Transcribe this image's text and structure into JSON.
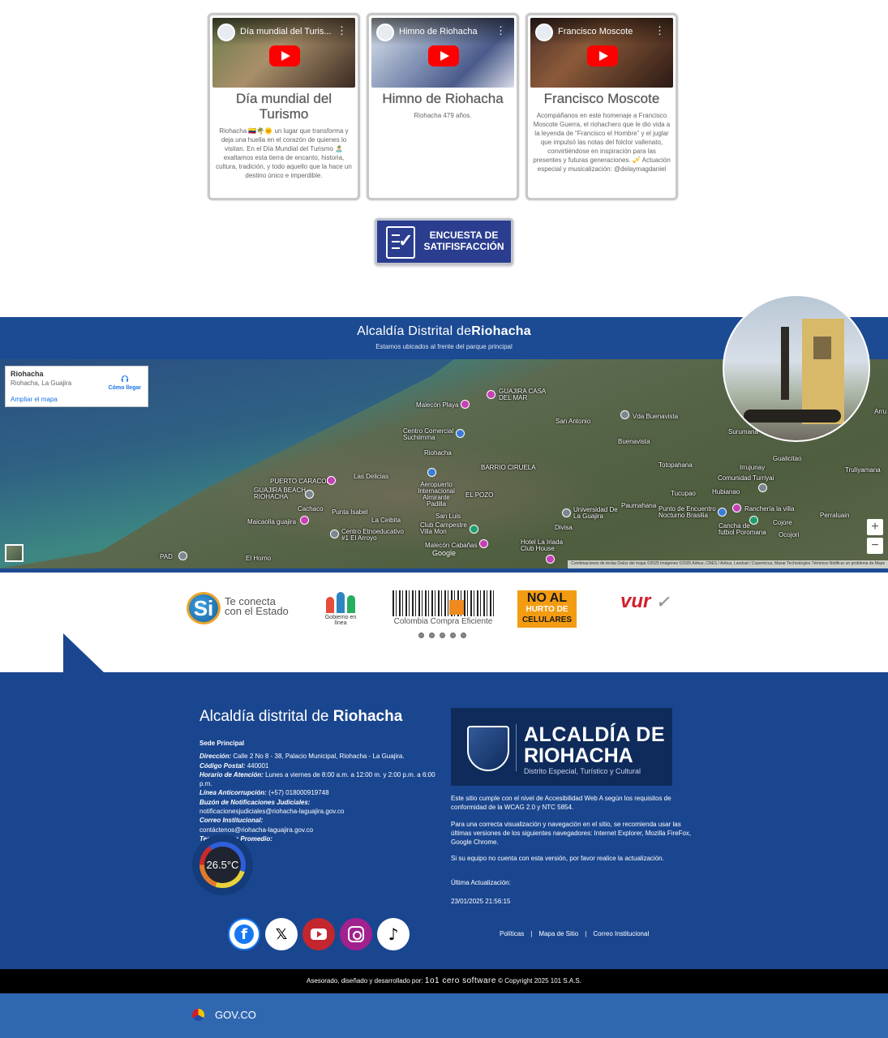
{
  "videos": [
    {
      "thumb_title": "Día mundial del Turis...",
      "title": "Día mundial del Turismo",
      "desc": "Riohacha 🇨🇴🌴🌞 un lugar que transforma y deja una huella en el corazón de quienes lo visitan. En el Día Mundial del Turismo 🏝️ exaltamos esta tierra de encanto, historia, cultura, tradición, y todo aquello que la hace un destino único e imperdible."
    },
    {
      "thumb_title": "Himno de Riohacha",
      "title": "Himno de Riohacha",
      "desc": "Riohacha 479 años."
    },
    {
      "thumb_title": "Francisco Moscote",
      "title": "Francisco Moscote",
      "desc": "Acompáñanos en este homenaje a Francisco Moscote Guerra, el riohachero que le dio vida a la leyenda de “Francisco el Hombre” y el juglar que impulsó las notas del folclor vallenato, convirtiéndose en inspiración para las presentes y futuras generaciones. 🎺 Actuación especial y musicalización: @delaymagdaniel"
    }
  ],
  "survey": {
    "line1": "ENCUESTA DE",
    "line2": "SATIFISFACCIÓN"
  },
  "map": {
    "title_prefix": "Alcaldía Distrital de",
    "title_bold": "Riohacha",
    "subtitle": "Estamos ubicados al frente del parque principal",
    "info_name": "Riohacha",
    "info_sub": "Riohacha, La Guajira",
    "info_link": "Ampliar el mapa",
    "info_dir": "Cómo llegar",
    "places": [
      "Malecón Playa",
      "GUAJIRA CASA DEL MAR",
      "San Antonio",
      "Vda Buenavista",
      "Centro Comercial Suchiimma",
      "Buenavista",
      "Surumana",
      "Arru",
      "Riohacha",
      "Totopahana",
      "Irrujunay",
      "Gualicitao",
      "Las Delicias",
      "BARRIO CIRUELA",
      "Comunidad Turriyai",
      "Truliyamana",
      "PUERTO CARACOL",
      "Aeropuerto Internacional Almirante Padilla",
      "GUAJIRA BEACH RIOHACHA",
      "EL POZO",
      "Tucupao",
      "Hubianao",
      "Cachaco",
      "Punta Isabel",
      "Universidad De La Guajira",
      "Paumahana",
      "Punto de Encuentro Nocturno Brasilia",
      "Ranchería la villa",
      "Maicaolla guajira",
      "La Ceibita",
      "San Luis",
      "Perraluain",
      "Club Campestre Villa Mon",
      "Divisa",
      "Cojore",
      "Centro Etnoeducativo #1 El Arroyo",
      "Cancha de futbol Poromana",
      "Ocojori",
      "PAD",
      "Malecón Cabañas",
      "Hotel La Iriada Club House",
      "El Horno"
    ],
    "google": "Google",
    "attribution": "Combinaciones de teclas  Datos del mapa ©2025 Imágenes ©2025 Airbus, CNES / Airbus, Landsat / Copernicus, Maxar Technologies  Términos  Notificar un problema de Maps",
    "zoom_in": "+",
    "zoom_out": "−"
  },
  "logos": {
    "si": "Te conecta con el Estado",
    "gob": "Gobierno en línea",
    "col": "Colombia Compra Eficiente",
    "noal_1": "NO AL",
    "noal_2": "HURTO DE",
    "noal_3": "CELULARES",
    "vur": "vur"
  },
  "footer": {
    "title_prefix": "Alcaldía distrital de",
    "title_bold": "Riohacha",
    "sede": "Sede Principal",
    "dir_label": "Dirección:",
    "dir": "Calle 2 No 8 - 38, Palacio Municipal, Riohacha - La Guajira.",
    "cp_label": "Código Postal:",
    "cp": "440001",
    "hor_label": "Horario de Atención:",
    "hor": "Lunes a viernes de 8:00 a.m. a 12:00 m. y 2:00 p.m. a 6:00 p.m.",
    "anti_label": "Línea Anticorrupción:",
    "anti": "(+57) 018000919748",
    "buzon_label": "Buzón de Notificaciones Judiciales:",
    "buzon": "notificacionesjudiciales@riohacha-laguajira.gov.co",
    "correo_label": "Correo Institucional:",
    "correo": "contáctenos@riohacha-laguajira.gov.co",
    "temp_label": "Temperatura Promedio:",
    "temp": "26.5°C",
    "logo_1": "ALCALDÍA DE",
    "logo_2": "RIOHACHA",
    "logo_3": "Distrito Especial, Turístico y Cultural",
    "p1": "Este sitio cumple con el nivel de Accesibilidad Web A según los requisitos de conformidad de la WCAG 2.0 y NTC 5854.",
    "p2": "Para una correcta visualización y navegación en el sitio, se recomienda usar las últimas versiones de los siguientes navegadores: Internet Explorer, Mozilla FireFox, Google Chrome.",
    "p3": "Si su equipo no cuenta con esta versión, por favor realice la actualización.",
    "upd_label": "Última Actualización:",
    "upd": "23/01/2025 21:56:15",
    "link_1": "Políticas",
    "link_2": "Mapa de Sitio",
    "link_3": "Correo Institucional",
    "sep": "|",
    "credit_prefix": "Asesorado, diseñado y desarrollado por:",
    "credit_brand": "1o1 cero software",
    "credit_suffix": "© Copyright 2025 101 S.A.S.",
    "gov": "GOV.CO"
  },
  "colors": {
    "footer_blue": "#1a468f",
    "map_header": "#1c4a93",
    "gov_bar": "#2f68b1",
    "youtube": "#ff0000"
  }
}
